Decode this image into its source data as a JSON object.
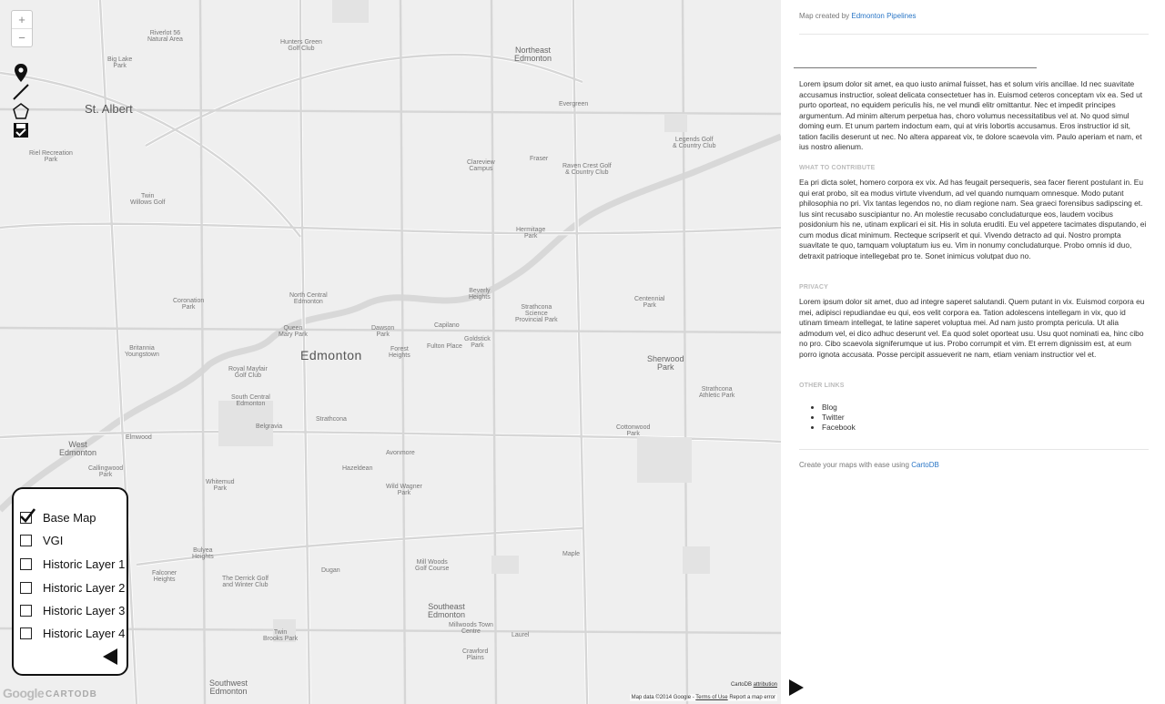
{
  "map": {
    "zoom_in": "+",
    "zoom_out": "−",
    "labels": [
      {
        "text": "Edmonton",
        "size": "xl"
      },
      {
        "text": "St. Albert",
        "size": "l"
      },
      {
        "text": "Northeast\nEdmonton",
        "size": "m"
      },
      {
        "text": "West\nEdmonton",
        "size": "m"
      },
      {
        "text": "Southeast\nEdmonton",
        "size": "m"
      },
      {
        "text": "Southwest\nEdmonton",
        "size": "m"
      },
      {
        "text": "Sherwood\nPark",
        "size": "m"
      },
      {
        "text": "Riverlot 56\nNatural Area",
        "size": "s"
      },
      {
        "text": "Hunters Green\nGolf Club",
        "size": "s"
      },
      {
        "text": "Big Lake\nPark",
        "size": "s"
      },
      {
        "text": "Riel Recreation\nPark",
        "size": "s"
      },
      {
        "text": "Twin\nWillows Golf",
        "size": "s"
      },
      {
        "text": "Legends Golf\n& Country Club",
        "size": "s"
      },
      {
        "text": "Raven Crest Golf\n& Country Club",
        "size": "s"
      },
      {
        "text": "Hermitage\nPark",
        "size": "s"
      },
      {
        "text": "Coronation\nPark",
        "size": "s"
      },
      {
        "text": "North Central\nEdmonton",
        "size": "s"
      },
      {
        "text": "Dawson\nPark",
        "size": "s"
      },
      {
        "text": "Forest\nHeights",
        "size": "s"
      },
      {
        "text": "Fulton Place",
        "size": "s"
      },
      {
        "text": "Strathcona\nScience\nProvincial Park",
        "size": "s"
      },
      {
        "text": "Centennial\nPark",
        "size": "s"
      },
      {
        "text": "Royal Mayfair\nGolf Club",
        "size": "s"
      },
      {
        "text": "South Central\nEdmonton",
        "size": "s"
      },
      {
        "text": "Strathcona",
        "size": "s"
      },
      {
        "text": "Callingwood\nPark",
        "size": "s"
      },
      {
        "text": "Whitemud\nPark",
        "size": "s"
      },
      {
        "text": "Mill Woods\nGolf Course",
        "size": "s"
      },
      {
        "text": "Cottonwood\nPark",
        "size": "s"
      },
      {
        "text": "Strathcona\nAthletic Park",
        "size": "s"
      },
      {
        "text": "Dugan",
        "size": "s"
      },
      {
        "text": "Hazeldean",
        "size": "s"
      },
      {
        "text": "Evergreen",
        "size": "s"
      },
      {
        "text": "Fraser",
        "size": "s"
      },
      {
        "text": "Beverly\nHeights",
        "size": "s"
      },
      {
        "text": "The Derrick Golf\nand Winter Club",
        "size": "s"
      },
      {
        "text": "Twin\nBrooks Park",
        "size": "s"
      },
      {
        "text": "Crawford\nPlains",
        "size": "s"
      },
      {
        "text": "Maple",
        "size": "s"
      },
      {
        "text": "Laurel",
        "size": "s"
      },
      {
        "text": "Millwoods Town\nCentre",
        "size": "s"
      },
      {
        "text": "Bulyea\nHeights",
        "size": "s"
      },
      {
        "text": "Falconer\nHeights",
        "size": "s"
      },
      {
        "text": "Wild Wagner\nPark",
        "size": "s"
      },
      {
        "text": "Elmwood",
        "size": "s"
      },
      {
        "text": "Belgravia",
        "size": "s"
      },
      {
        "text": "Avonmore",
        "size": "s"
      },
      {
        "text": "Queen\nMary Park",
        "size": "s"
      },
      {
        "text": "Capilano",
        "size": "s"
      },
      {
        "text": "Goldstick\nPark",
        "size": "s"
      },
      {
        "text": "Britannia\nYoungstown",
        "size": "s"
      },
      {
        "text": "Clareview\nCampus",
        "size": "s"
      }
    ],
    "layers_panel": {
      "items": [
        {
          "label": "Base Map",
          "checked": true
        },
        {
          "label": "VGI",
          "checked": false
        },
        {
          "label": "Historic Layer 1",
          "checked": false
        },
        {
          "label": "Historic Layer 2",
          "checked": false
        },
        {
          "label": "Historic Layer 3",
          "checked": false
        },
        {
          "label": "Historic Layer 4",
          "checked": false
        }
      ]
    },
    "google_logo": "Google",
    "carto_logo": "CARTODB",
    "attribution": {
      "prefix": "CartoDB",
      "link": "attribution"
    },
    "map_data": {
      "text": "Map data ©2014 Google -",
      "terms": "Terms of Use",
      "report": "Report a map error"
    }
  },
  "panel": {
    "created_prefix": "Map created by",
    "created_link": "Edmonton Pipelines",
    "intro": "Lorem ipsum dolor sit amet, ea quo iusto animal fuisset, has et solum viris ancillae. Id nec suavitate accusamus instructior, soleat delicata consectetuer has in. Euismod ceteros conceptam vix ea. Sed ut purto oporteat, no equidem periculis his, ne vel mundi elitr omittantur. Nec et impedit principes argumentum. Ad minim alterum perpetua has, choro volumus necessitatibus vel at. No quod simul doming eum. Et unum partem indoctum eam, qui at viris lobortis accusamus. Eros instructior id sit, tation facilis deserunt ut nec. No altera appareat vix, te dolore scaevola vim. Paulo aperiam et nam, et ius nostro alienum.",
    "contribute_heading": "WHAT TO CONTRIBUTE",
    "contribute": "Ea pri dicta solet, homero corpora ex vix. Ad has feugait persequeris, sea facer fierent postulant in. Eu qui erat probo, sit ea modus virtute vivendum, ad vel quando numquam omnesque. Modo putant philosophia no pri. Vix tantas legendos no, no diam regione nam. Sea graeci forensibus sadipscing et. Ius sint recusabo suscipiantur no. An molestie recusabo concludaturque eos, laudem vocibus posidonium his ne, utinam explicari ei sit. His in soluta eruditi. Eu vel appetere tacimates disputando, ei cum modus dicat minimum. Recteque scripserit et qui. Vivendo detracto ad qui. Nostro prompta suavitate te quo, tamquam voluptatum ius eu. Vim in nonumy concludaturque. Probo omnis id duo, detraxit patrioque intellegebat pro te. Sonet inimicus volutpat duo no.",
    "privacy_heading": "PRIVACY",
    "privacy": "Lorem ipsum dolor sit amet, duo ad integre saperet salutandi. Quem putant in vix. Euismod corpora eu mei, adipisci repudiandae eu qui, eos velit corpora ea. Tation adolescens intellegam in vix, quo id utinam timeam intellegat, te latine saperet voluptua mei. Ad nam justo prompta pericula. Ut alia admodum vel, ei dico adhuc deserunt vel. Ea quod solet oporteat usu. Usu quot nominati ea, hinc cibo no pro. Cibo scaevola signiferumque ut ius. Probo corrumpit et vim. Et errem dignissim est, at eum porro ignota accusata. Posse percipit assueverit ne nam, etiam veniam instructior vel et.",
    "links_heading": "OTHER LINKS",
    "links": [
      "Blog",
      "Twitter",
      "Facebook"
    ],
    "footer_prefix": "Create your maps with ease using",
    "footer_link": "CartoDB"
  }
}
